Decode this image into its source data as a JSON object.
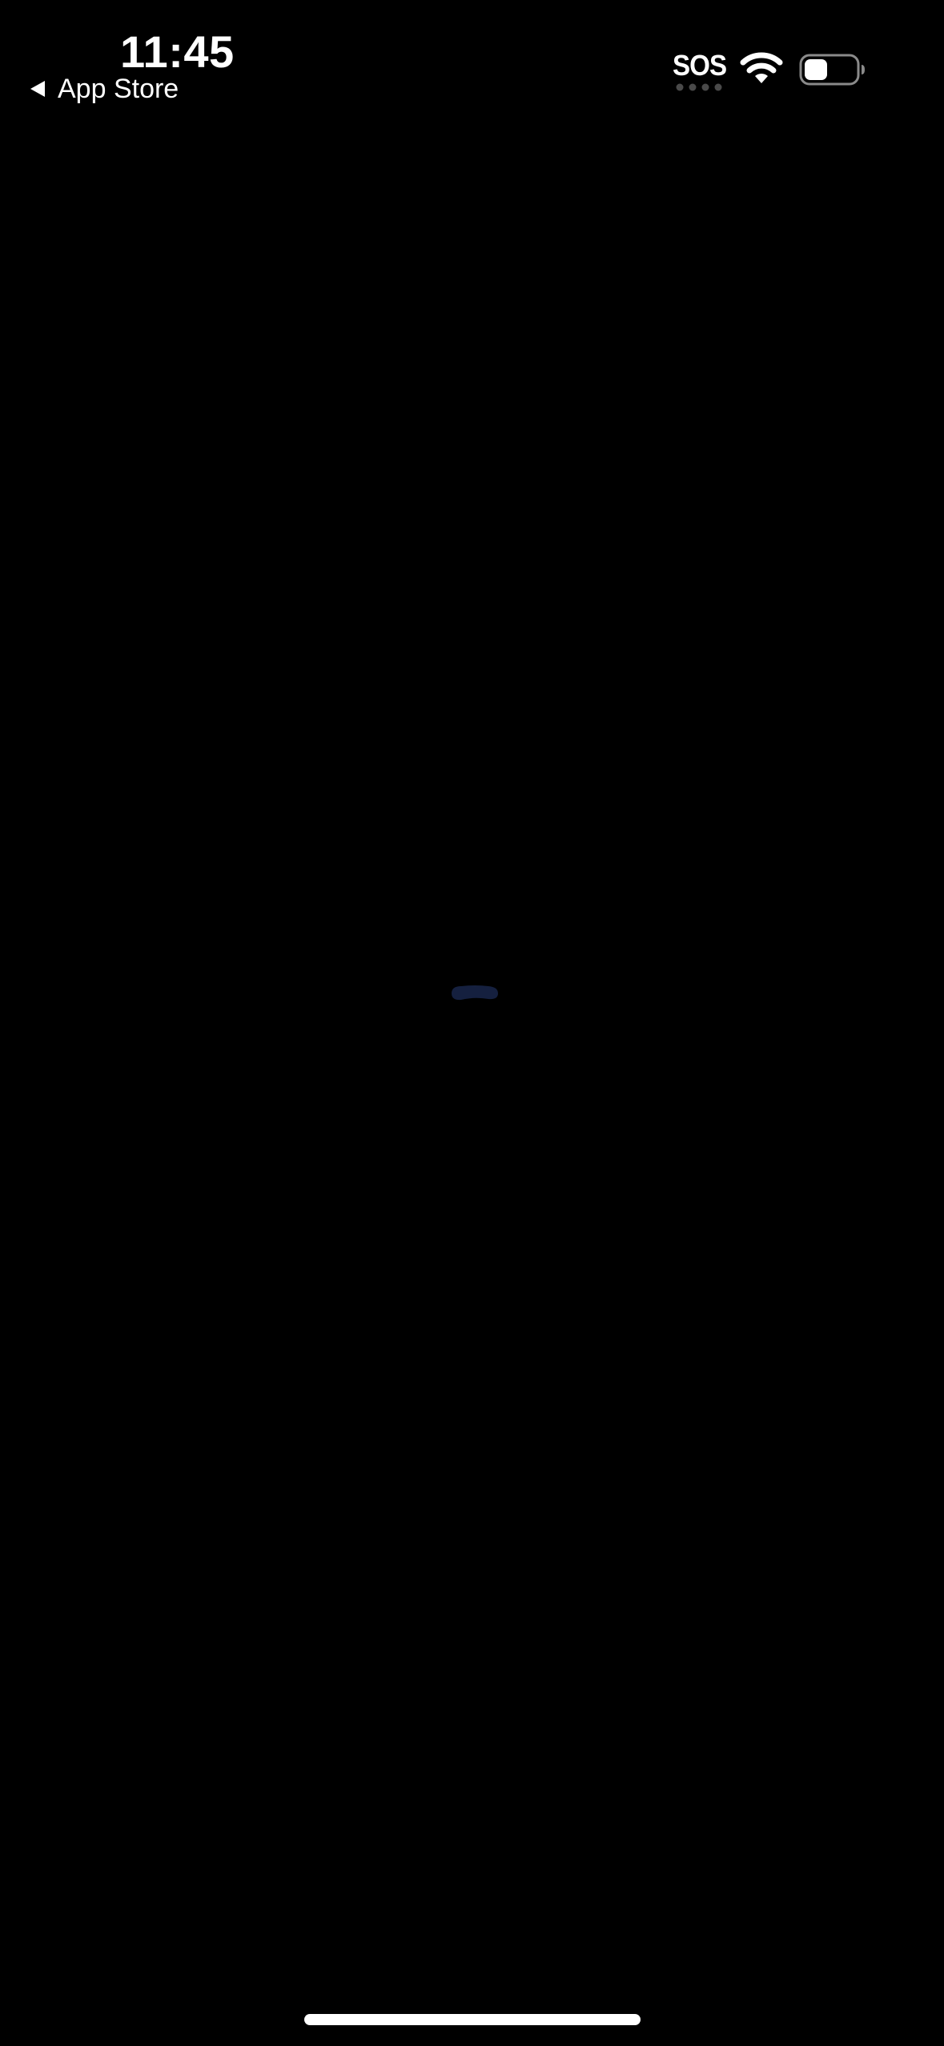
{
  "status_bar": {
    "time": "11:45",
    "back_label": "App Store",
    "back_icon": "back-triangle-icon",
    "sos_label": "SOS",
    "signal_dots_active": 0,
    "signal_dots_total": 4,
    "wifi_icon": "wifi-icon",
    "battery_icon": "battery-icon",
    "battery_level": 0.45
  },
  "main": {
    "loading_indicator": "loading-spinner-icon",
    "loader_color": "#15203F"
  },
  "colors": {
    "background": "#000000",
    "foreground": "#FFFFFF",
    "inactive_signal": "#4A4A4A"
  }
}
